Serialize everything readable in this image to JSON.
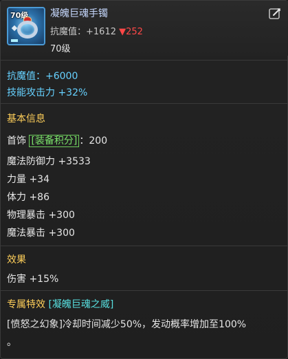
{
  "item": {
    "name": "凝魄巨魂手镯",
    "level_badge": "70级",
    "compare_label": "抗魔值：",
    "compare_up": "+1612",
    "compare_down": "▼252",
    "level": "70级"
  },
  "bonus": {
    "line1": "抗魔值：+6000",
    "line2": "技能攻击力 +32%"
  },
  "basic": {
    "title": "基本信息",
    "slot_prefix": "首饰",
    "score_label": "[装备积分]",
    "score_value": "：200",
    "stats": [
      "魔法防御力 +3533",
      "力量 +34",
      "体力 +86",
      "物理暴击 +300",
      "魔法暴击 +300"
    ]
  },
  "effect": {
    "title": "效果",
    "line": "伤害 +15%"
  },
  "special": {
    "title": "专属特效",
    "name": "[凝魄巨魂之威]",
    "desc_line1": "[愤怒之幻象]冷却时间减少50%，发动概率增加至100%",
    "desc_line2": "。"
  },
  "colors": {
    "accent_blue": "#66d1ff",
    "section_gold": "#ffcf5a",
    "score_green": "#7be36b",
    "down_red": "#ff4747",
    "special_cyan": "#58e0e0"
  }
}
